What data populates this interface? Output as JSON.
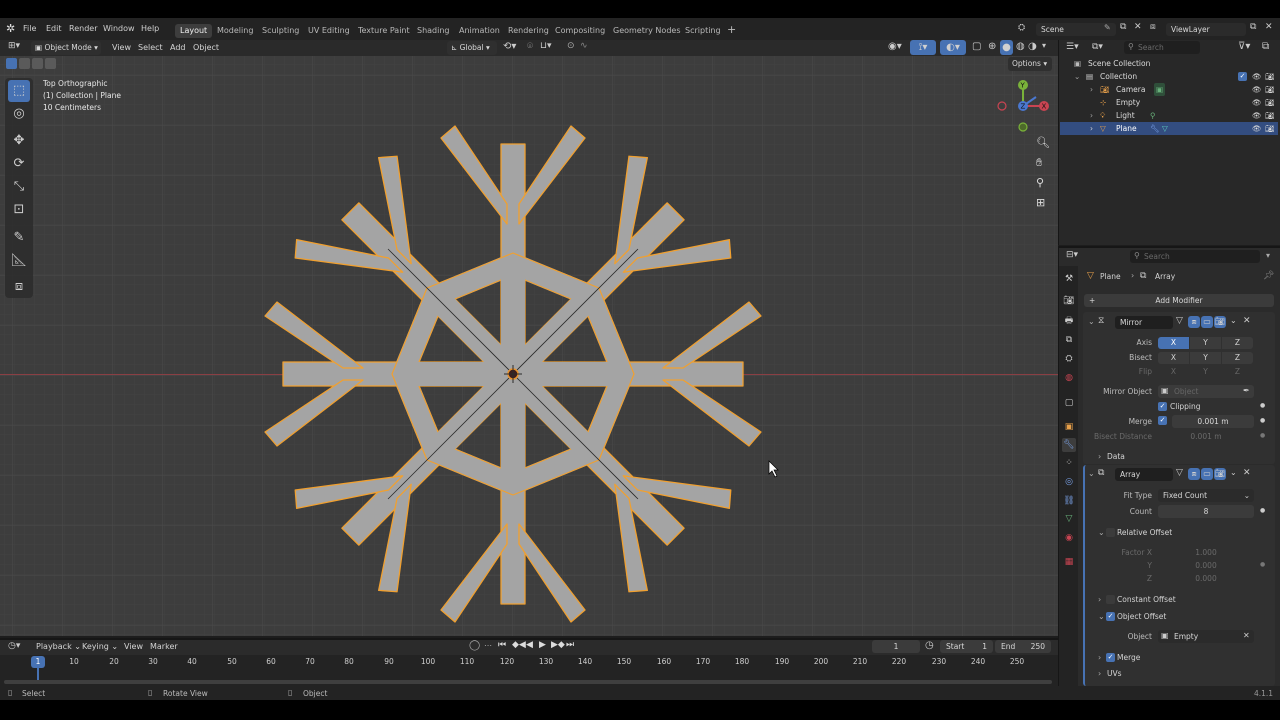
{
  "menu": {
    "items": [
      "File",
      "Edit",
      "Render",
      "Window",
      "Help"
    ]
  },
  "workspaces": [
    "Layout",
    "Modeling",
    "Sculpting",
    "UV Editing",
    "Texture Paint",
    "Shading",
    "Animation",
    "Rendering",
    "Compositing",
    "Geometry Nodes",
    "Scripting"
  ],
  "scene": {
    "name": "Scene",
    "view_layer": "ViewLayer"
  },
  "viewport": {
    "mode": "Object Mode",
    "menus": [
      "View",
      "Select",
      "Add",
      "Object"
    ],
    "transform_orientation": "Global",
    "options_label": "Options",
    "info_lines": [
      "Top Orthographic",
      "(1) Collection | Plane",
      "10 Centimeters"
    ],
    "gizmo": {
      "x": "X",
      "y": "Y",
      "z": "Z"
    }
  },
  "outliner": {
    "search_placeholder": "Search",
    "scene_collection": "Scene Collection",
    "collection": "Collection",
    "objects": [
      {
        "name": "Camera"
      },
      {
        "name": "Empty"
      },
      {
        "name": "Light"
      },
      {
        "name": "Plane",
        "selected": true
      }
    ]
  },
  "properties": {
    "search_placeholder": "Search",
    "breadcrumb": [
      "Plane",
      "Array"
    ],
    "add_modifier": "Add Modifier",
    "mirror": {
      "name": "Mirror",
      "axis_label": "Axis",
      "bisect_label": "Bisect",
      "flip_label": "Flip",
      "axes": [
        "X",
        "Y",
        "Z"
      ],
      "mirror_object_label": "Mirror Object",
      "mirror_object_placeholder": "Object",
      "clipping_label": "Clipping",
      "merge_label": "Merge",
      "merge_value": "0.001 m",
      "bisect_distance_label": "Bisect Distance",
      "bisect_distance_value": "0.001 m",
      "data_label": "Data"
    },
    "array": {
      "name": "Array",
      "fit_type_label": "Fit Type",
      "fit_type_value": "Fixed Count",
      "count_label": "Count",
      "count_value": "8",
      "relative_offset_label": "Relative Offset",
      "factor_x_label": "Factor X",
      "y_label": "Y",
      "z_label": "Z",
      "factor_values": [
        "1.000",
        "0.000",
        "0.000"
      ],
      "constant_offset_label": "Constant Offset",
      "object_offset_label": "Object Offset",
      "object_label": "Object",
      "object_value": "Empty",
      "merge_label": "Merge",
      "uvs_label": "UVs"
    }
  },
  "timeline": {
    "menus": [
      "Playback",
      "Keying",
      "View",
      "Marker"
    ],
    "current_frame": "1",
    "start_label": "Start",
    "start_value": "1",
    "end_label": "End",
    "end_value": "250",
    "ticks": [
      "10",
      "20",
      "30",
      "40",
      "50",
      "60",
      "70",
      "80",
      "90",
      "100",
      "110",
      "120",
      "130",
      "140",
      "150",
      "160",
      "170",
      "180",
      "190",
      "200",
      "210",
      "220",
      "230",
      "240",
      "250"
    ],
    "frame_marker": "1"
  },
  "statusbar": {
    "items": [
      "Select",
      "Rotate View",
      "Object"
    ],
    "version": "4.1.1"
  },
  "colors": {
    "accent": "#4772b3",
    "selection_outline": "#f0a030",
    "mesh_fill": "#a4a4a4",
    "viewport_bg": "#3d3d3d"
  }
}
